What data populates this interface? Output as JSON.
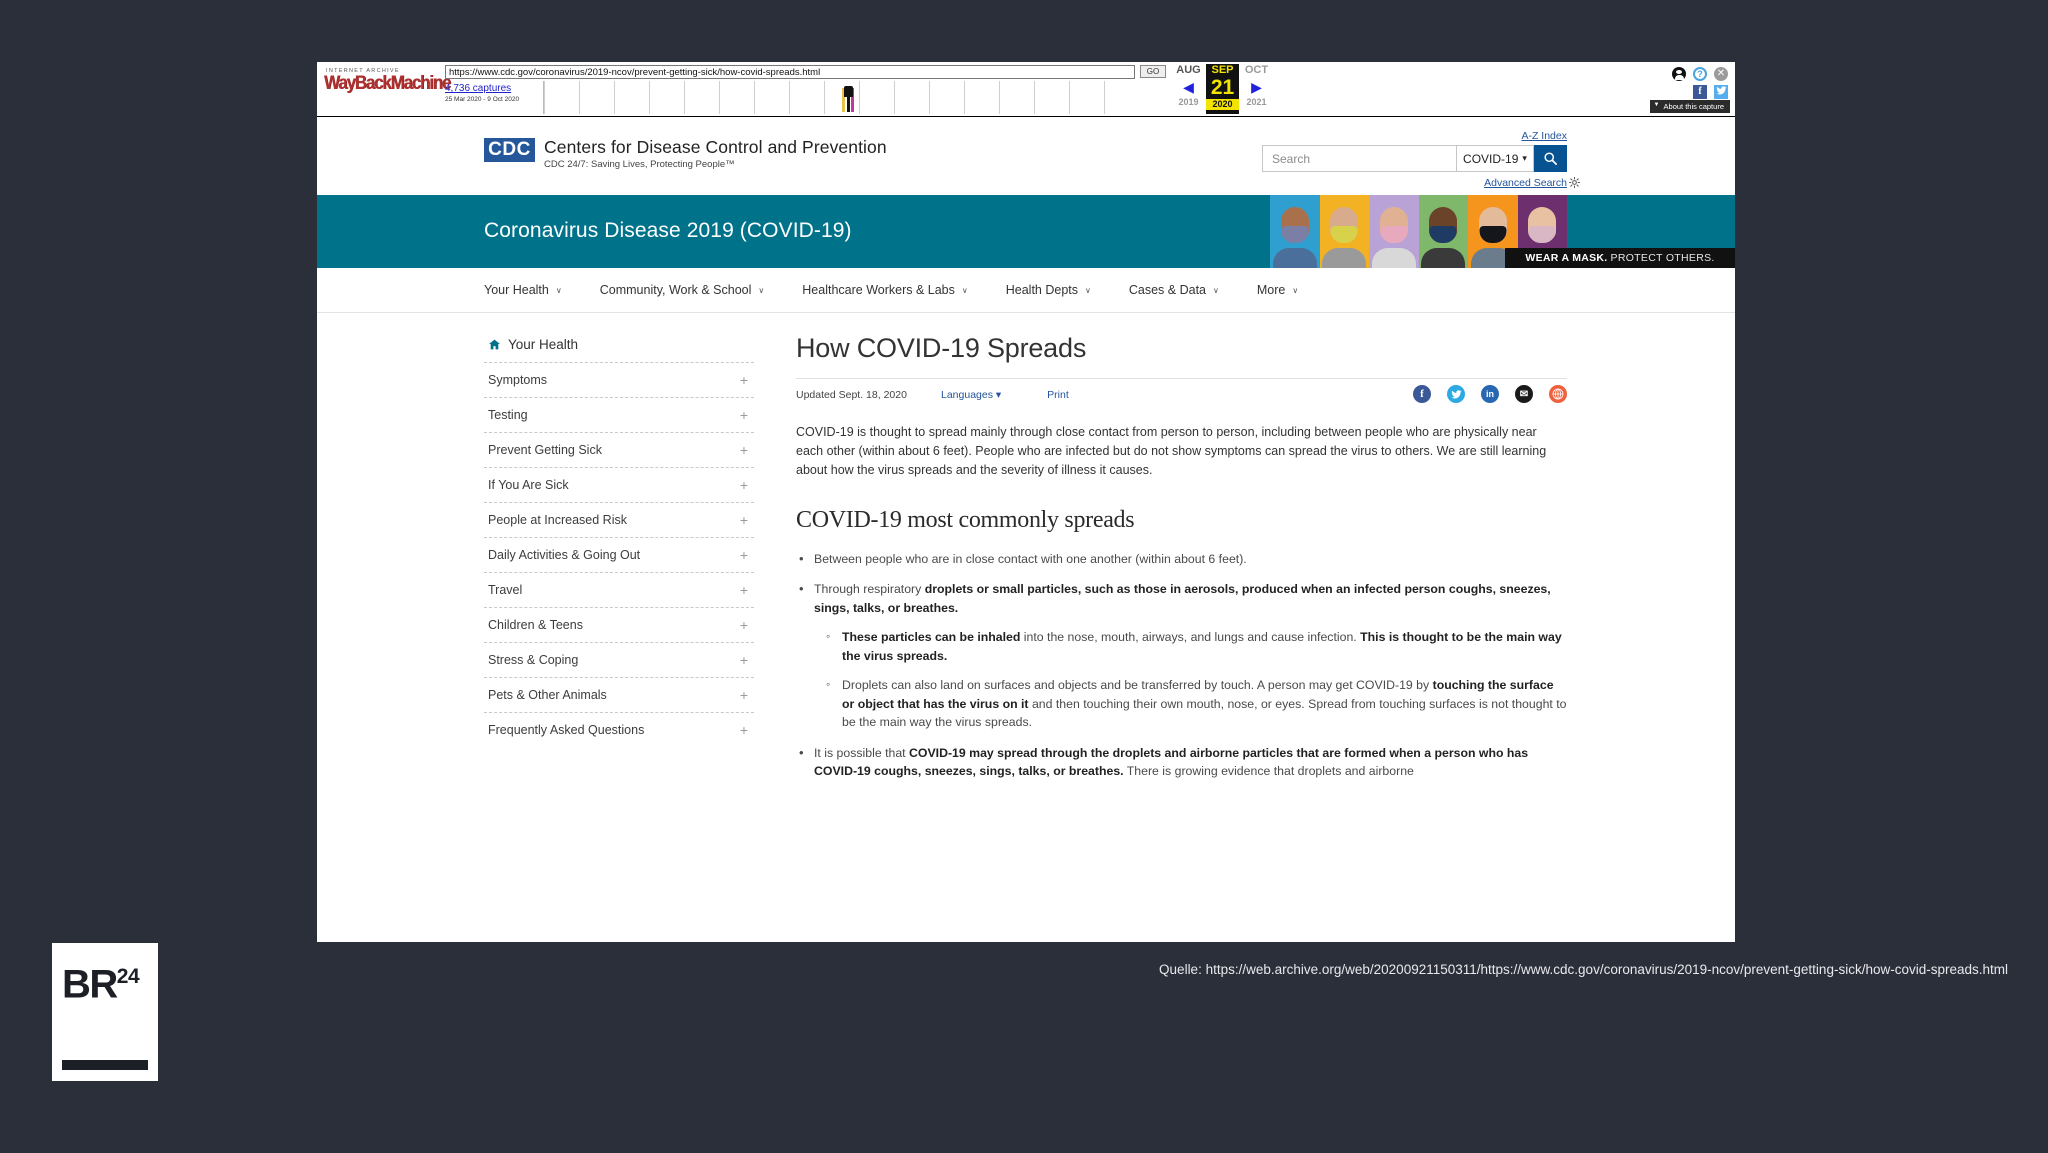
{
  "wayback": {
    "archive_label": "INTERNET ARCHIVE",
    "logo_text": "WayBackMachine",
    "url": "https://www.cdc.gov/coronavirus/2019-ncov/prevent-getting-sick/how-covid-spreads.html",
    "go_label": "GO",
    "captures_count": "4,736 captures",
    "captures_range": "25 Mar 2020 - 9 Oct 2020",
    "prev_month": "AUG",
    "prev_year": "2019",
    "current_month": "SEP",
    "current_day": "21",
    "current_year": "2020",
    "next_month": "OCT",
    "next_year": "2021",
    "prev_arrow": "◀",
    "next_arrow": "▶",
    "help_label": "?",
    "close_label": "✕",
    "facebook_label": "f",
    "twitter_label": "🐦",
    "about_label": "About this capture"
  },
  "cdc_header": {
    "logo_mark": "CDC",
    "logo_title": "Centers for Disease Control and Prevention",
    "logo_tagline": "CDC 24/7: Saving Lives, Protecting People™",
    "az_index": "A-Z Index",
    "advanced_search": "Advanced Search",
    "search_placeholder": "Search",
    "search_value": "",
    "search_scope": "COVID-19",
    "search_scope_caret": "▾",
    "search_button_icon": "search-icon"
  },
  "banner": {
    "title": "Coronavirus Disease 2019 (COVID-19)",
    "bg_color": "#00738b",
    "caption_bold": "WEAR A MASK.",
    "caption_light": "PROTECT OTHERS.",
    "mask_tiles": [
      {
        "bg": "#2f9fd0",
        "skin": "#a9714b",
        "mask": "#7b7fa6",
        "body": "#4a6f9a"
      },
      {
        "bg": "#f2b223",
        "skin": "#d8ab8c",
        "mask": "#d7d24a",
        "body": "#9a9a9a"
      },
      {
        "bg": "#b9a2d6",
        "skin": "#e0b293",
        "mask": "#e8a8bd",
        "body": "#d8d8d8"
      },
      {
        "bg": "#7fb86b",
        "skin": "#6b4329",
        "mask": "#1f3a63",
        "body": "#3a3a3a"
      },
      {
        "bg": "#f5951e",
        "skin": "#e3bb9a",
        "mask": "#14161c",
        "body": "#6b7d8c"
      },
      {
        "bg": "#6d2f6d",
        "skin": "#e8c0a2",
        "mask": "#d9b7c4",
        "body": "#7a4a6a"
      }
    ]
  },
  "nav": {
    "items": [
      {
        "label": "Your Health",
        "caret": "∨"
      },
      {
        "label": "Community, Work & School",
        "caret": "∨"
      },
      {
        "label": "Healthcare Workers & Labs",
        "caret": "∨"
      },
      {
        "label": "Health Depts",
        "caret": "∨"
      },
      {
        "label": "Cases & Data",
        "caret": "∨"
      },
      {
        "label": "More",
        "caret": "∨"
      }
    ]
  },
  "sidebar": {
    "home_label": "Your Health",
    "home_icon": "home-icon",
    "items": [
      {
        "label": "Symptoms",
        "expand": "+"
      },
      {
        "label": "Testing",
        "expand": "+"
      },
      {
        "label": "Prevent Getting Sick",
        "expand": "+"
      },
      {
        "label": "If You Are Sick",
        "expand": "+"
      },
      {
        "label": "People at Increased Risk",
        "expand": "+"
      },
      {
        "label": "Daily Activities & Going Out",
        "expand": "+"
      },
      {
        "label": "Travel",
        "expand": "+"
      },
      {
        "label": "Children & Teens",
        "expand": "+"
      },
      {
        "label": "Stress & Coping",
        "expand": "+"
      },
      {
        "label": "Pets & Other Animals",
        "expand": "+"
      },
      {
        "label": "Frequently Asked Questions",
        "expand": "+"
      }
    ]
  },
  "main": {
    "title": "How COVID-19 Spreads",
    "updated": "Updated Sept. 18, 2020",
    "languages_label": "Languages ▾",
    "print_label": "Print",
    "social": [
      {
        "name": "facebook-share-icon",
        "glyph": "f",
        "color": "#3b5998"
      },
      {
        "name": "twitter-share-icon",
        "glyph": "ᴛ",
        "color": "#2daae1"
      },
      {
        "name": "linkedin-share-icon",
        "glyph": "in",
        "color": "#2867b2"
      },
      {
        "name": "email-share-icon",
        "glyph": "✉",
        "color": "#1a1a1a"
      },
      {
        "name": "syndicate-share-icon",
        "glyph": "✳",
        "color": "#f0603c"
      }
    ],
    "intro": "COVID-19 is thought to spread mainly through close contact from person to person, including between people who are physically near each other (within about 6 feet). People who are infected but do not show symptoms can spread the virus to others. We are still learning about how the virus spreads and the severity of illness it causes.",
    "heading2": "COVID-19 most commonly spreads",
    "bullet1": "Between people who are in close contact with one another (within about 6 feet).",
    "bullet2_plain": "Through respiratory ",
    "bullet2_bold": "droplets or small particles, such as those in aerosols, produced when an infected person coughs, sneezes, sings, talks, or breathes.",
    "sub1_bold1": "These particles can be inhaled ",
    "sub1_plain": "into the nose, mouth, airways, and lungs and cause infection. ",
    "sub1_bold2": "This is thought to be the main way the virus spreads.",
    "sub2_plain1": "Droplets can also land on surfaces and objects and be transferred by touch. A person may get COVID-19 by ",
    "sub2_bold": "touching the surface or object that has the virus on it",
    "sub2_plain2": " and then touching their own mouth, nose, or eyes. Spread from touching surfaces is not thought to be the main way the virus spreads.",
    "bullet3_plain1": "It is possible that ",
    "bullet3_bold": "COVID-19 may spread through the droplets and airborne particles that are formed when a person who has COVID-19 coughs, sneezes, sings, talks, or breathes.",
    "bullet3_plain2": " There is growing evidence that droplets and airborne"
  },
  "overlay": {
    "br24_main": "BR",
    "br24_sup": "24",
    "source_caption": "Quelle: https://web.archive.org/web/20200921150311/https://www.cdc.gov/coronavirus/2019-ncov/prevent-getting-sick/how-covid-spreads.html"
  }
}
